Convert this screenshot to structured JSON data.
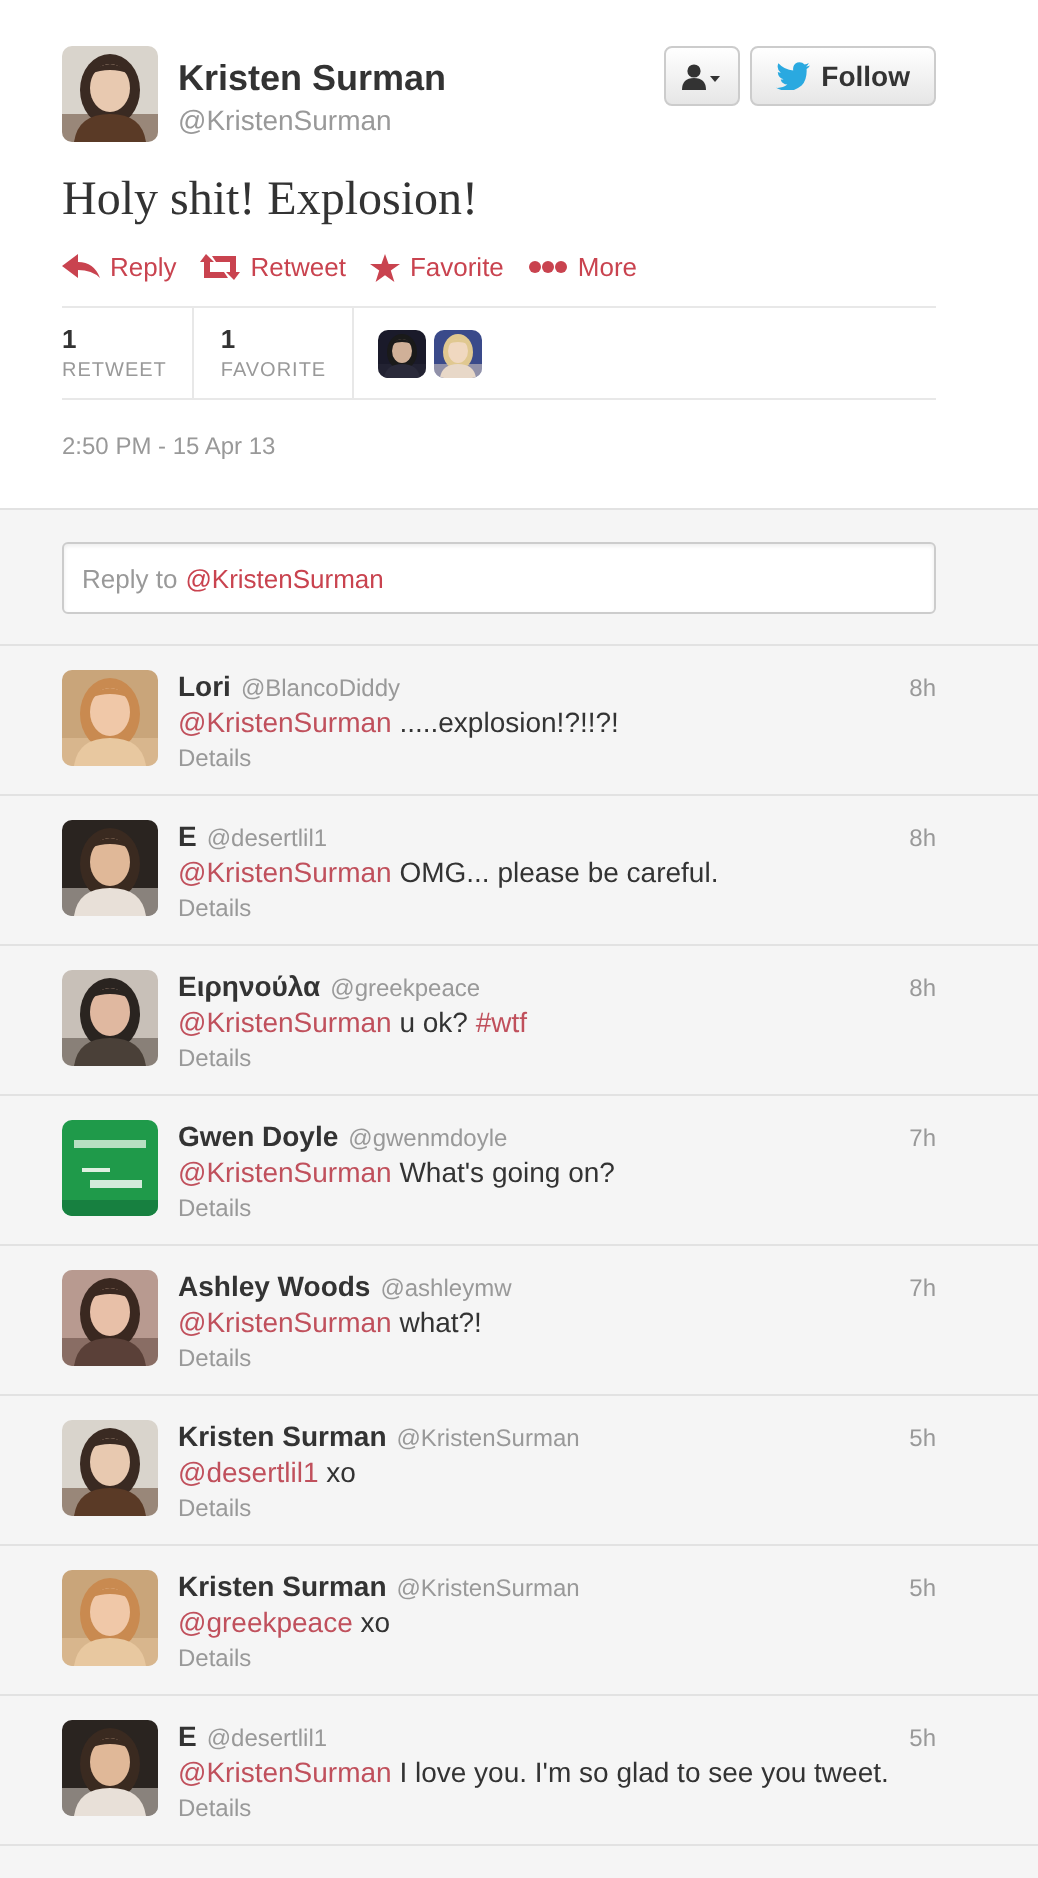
{
  "tweet": {
    "author": {
      "name": "Kristen Surman",
      "handle": "@KristenSurman",
      "avatar": {
        "kind": "picture"
      }
    },
    "buttons": [
      {
        "kind": "user-menu"
      },
      {
        "kind": "follow",
        "label": "Follow"
      }
    ],
    "text": "Holy shit! Explosion!",
    "actions": [
      {
        "kind": "reply",
        "label": "Reply"
      },
      {
        "kind": "retweet",
        "label": "Retweet"
      },
      {
        "kind": "favorite",
        "label": "Favorite"
      },
      {
        "kind": "more",
        "label": "More"
      }
    ],
    "stats": [
      {
        "count": "1",
        "label": "RETWEET"
      },
      {
        "count": "1",
        "label": "FAVORITE"
      }
    ],
    "retweeters": [
      {
        "kind": "picture"
      },
      {
        "kind": "picture"
      }
    ],
    "timestamp": "2:50 PM - 15 Apr 13"
  },
  "reply_box": {
    "prompt": "Reply to",
    "mention": "@KristenSurman"
  },
  "replies": [
    {
      "name": "Lori",
      "handle": "@BlancoDiddy",
      "time": "8h",
      "segments": [
        {
          "kind": "mention",
          "text": "@KristenSurman"
        },
        {
          "kind": "text",
          "text": ".....explosion!?!!?!"
        }
      ],
      "details": "Details",
      "avatar": {
        "kind": "picture"
      }
    },
    {
      "name": "E",
      "handle": "@desertlil1",
      "time": "8h",
      "segments": [
        {
          "kind": "mention",
          "text": "@KristenSurman"
        },
        {
          "kind": "text",
          "text": "OMG... please be careful."
        }
      ],
      "details": "Details",
      "avatar": {
        "kind": "picture"
      }
    },
    {
      "name": "Ειρηνούλα",
      "handle": "@greekpeace",
      "time": "8h",
      "segments": [
        {
          "kind": "mention",
          "text": "@KristenSurman"
        },
        {
          "kind": "text",
          "text": "u ok?"
        },
        {
          "kind": "hashtag",
          "text": "#wtf"
        }
      ],
      "details": "Details",
      "avatar": {
        "kind": "picture"
      }
    },
    {
      "name": "Gwen Doyle",
      "handle": "@gwenmdoyle",
      "time": "7h",
      "segments": [
        {
          "kind": "mention",
          "text": "@KristenSurman"
        },
        {
          "kind": "text",
          "text": "What's going on?"
        }
      ],
      "details": "Details",
      "avatar": {
        "kind": "picture"
      }
    },
    {
      "name": "Ashley Woods",
      "handle": "@ashleymw",
      "time": "7h",
      "segments": [
        {
          "kind": "mention",
          "text": "@KristenSurman"
        },
        {
          "kind": "text",
          "text": "what?!"
        }
      ],
      "details": "Details",
      "avatar": {
        "kind": "picture"
      }
    },
    {
      "name": "Kristen Surman",
      "handle": "@KristenSurman",
      "time": "5h",
      "segments": [
        {
          "kind": "mention",
          "text": "@desertlil1"
        },
        {
          "kind": "text",
          "text": "xo"
        }
      ],
      "details": "Details",
      "avatar": {
        "kind": "picture"
      }
    },
    {
      "name": "Kristen Surman",
      "handle": "@KristenSurman",
      "time": "5h",
      "segments": [
        {
          "kind": "mention",
          "text": "@greekpeace"
        },
        {
          "kind": "text",
          "text": "xo"
        }
      ],
      "details": "Details",
      "avatar": {
        "kind": "picture"
      }
    },
    {
      "name": "E",
      "handle": "@desertlil1",
      "time": "5h",
      "segments": [
        {
          "kind": "mention",
          "text": "@KristenSurman"
        },
        {
          "kind": "text",
          "text": "I love you. I'm so glad to see you tweet."
        }
      ],
      "details": "Details",
      "avatar": {
        "kind": "picture"
      }
    }
  ]
}
